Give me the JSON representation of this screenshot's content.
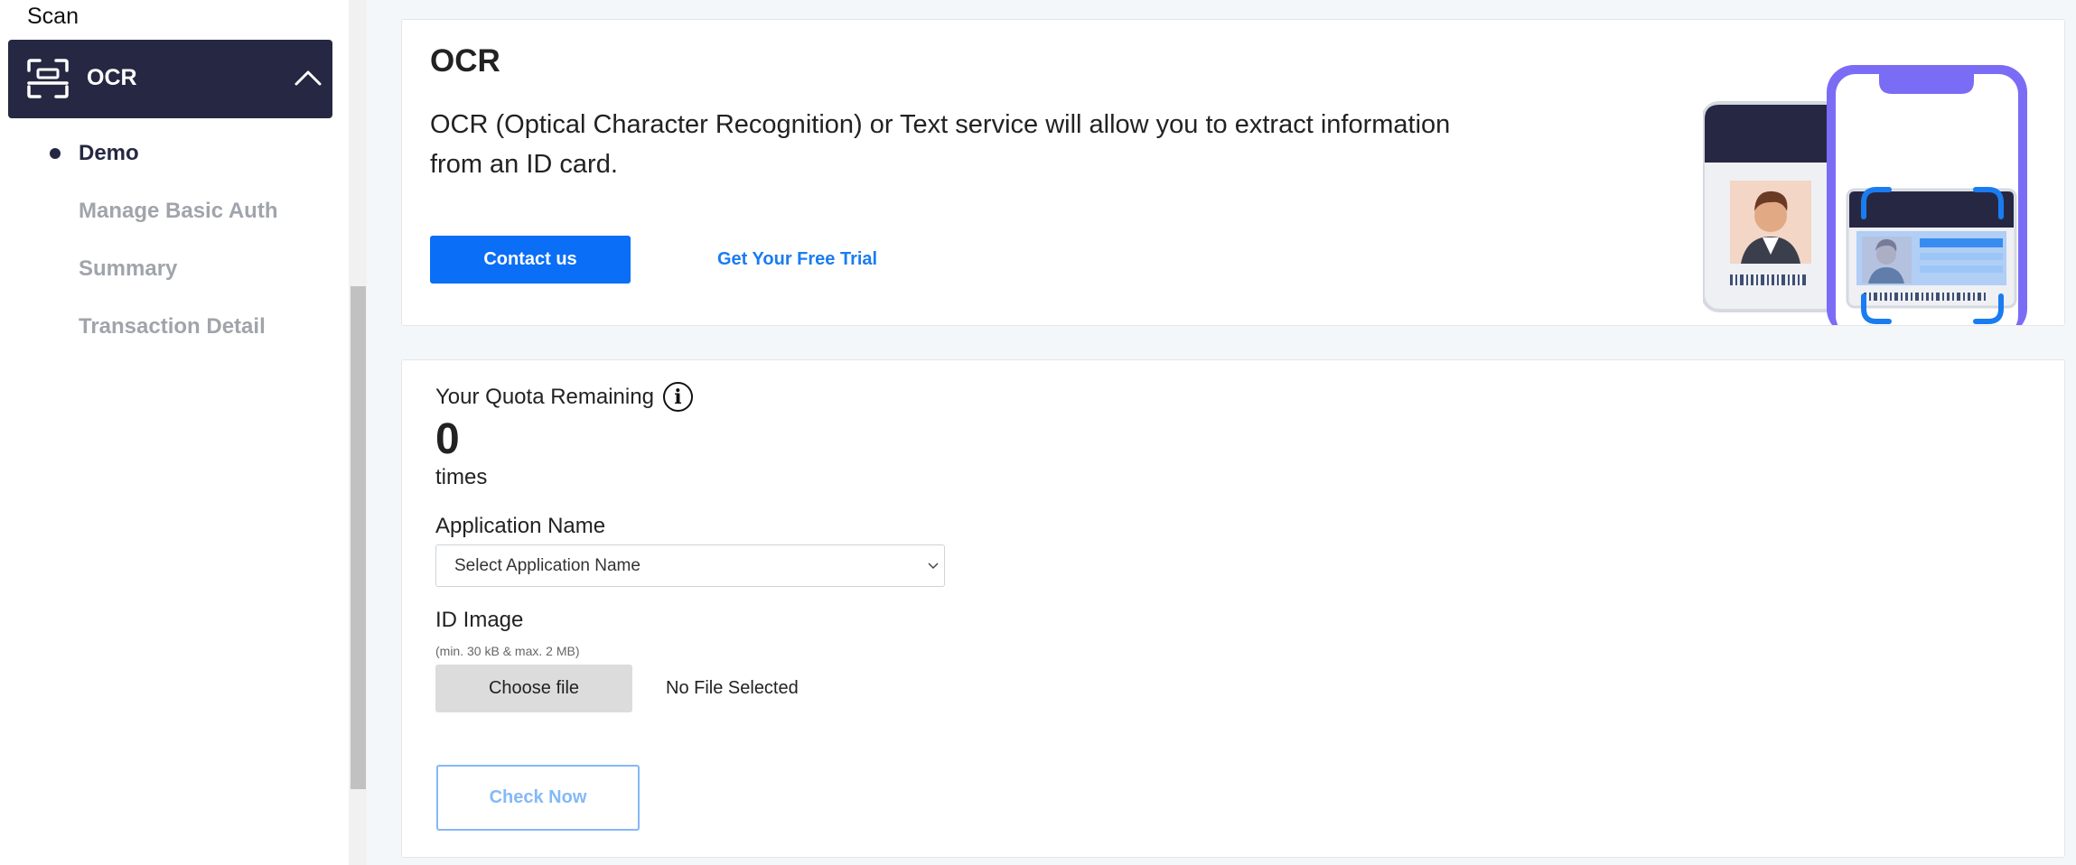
{
  "sidebar": {
    "section_label": "Scan",
    "active_group": {
      "label": "OCR",
      "icon": "scan-frame-icon",
      "expand_icon": "chevron-up-icon"
    },
    "items": [
      {
        "label": "Demo",
        "active": true
      },
      {
        "label": "Manage Basic Auth",
        "active": false
      },
      {
        "label": "Summary",
        "active": false
      },
      {
        "label": "Transaction Detail",
        "active": false
      }
    ]
  },
  "hero": {
    "title": "OCR",
    "description": "OCR (Optical Character Recognition) or Text service will allow you to extract information from an ID card.",
    "contact_label": "Contact us",
    "trial_label": "Get Your Free Trial"
  },
  "quota": {
    "label": "Your Quota Remaining",
    "info_icon": "info-icon",
    "value": "0",
    "unit": "times"
  },
  "form": {
    "app_name_label": "Application Name",
    "app_name_placeholder": "Select Application Name",
    "id_image_label": "ID Image",
    "id_image_hint": "(min. 30 kB & max. 2 MB)",
    "choose_file_label": "Choose file",
    "file_status": "No File Selected",
    "check_label": "Check Now"
  },
  "colors": {
    "sidebar_active_bg": "#262843",
    "primary": "#0a6ef7",
    "link": "#1a7cf0",
    "disabled_text": "#a0a4ab",
    "check_button": "#84b9f6",
    "phone_frame": "#7b6cf5"
  }
}
